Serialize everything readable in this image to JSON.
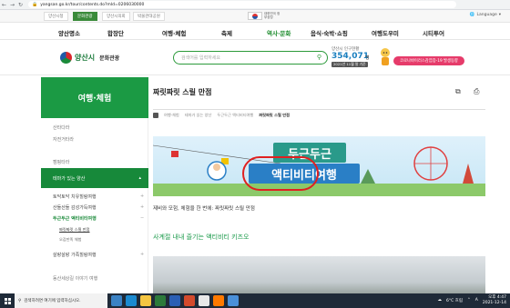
{
  "browser": {
    "url": "yangsan.go.kr/tour/contents.do?mId=0206030000",
    "lock_icon": "lock-icon"
  },
  "site_tabs": [
    {
      "label": "양산시청",
      "active": false
    },
    {
      "label": "문화관광",
      "active": true
    },
    {
      "label": "양산시의회",
      "active": false
    },
    {
      "label": "박물관대공원",
      "active": false
    }
  ],
  "emblem_text": "대한민국 정부상징",
  "language": "Language",
  "main_nav": [
    {
      "label": "양산명소",
      "highlight": false
    },
    {
      "label": "합장단",
      "highlight": false
    },
    {
      "label": "여행·체험",
      "highlight": false
    },
    {
      "label": "축제",
      "highlight": false
    },
    {
      "label": "역사·문화",
      "highlight": true
    },
    {
      "label": "음식·숙박·쇼핑",
      "highlight": false
    },
    {
      "label": "여행도우미",
      "highlight": false
    },
    {
      "label": "시티투어",
      "highlight": false
    }
  ],
  "logo": {
    "name": "양산시",
    "sub": "문화관광"
  },
  "search": {
    "placeholder": "검색어를 입력하세요"
  },
  "population": {
    "label": "양산시 인구현황",
    "value": "354,071",
    "unit": "명",
    "date": "2021년 11월 말 기준"
  },
  "covid_button": "코로나바이러스감염증-19 발생동향",
  "sidebar": {
    "header": "여행·체험",
    "items": [
      {
        "label": "산타다라"
      },
      {
        "label": "자전거타라"
      },
      {
        "label": "캠핑타라"
      }
    ],
    "highlight": "테마가 있는 양산",
    "sub_items": [
      {
        "label": "토닥토닥 치유힐링여행",
        "on": false
      },
      {
        "label": "산들산들 감성가득여행",
        "on": false
      },
      {
        "label": "두근두근 액티비티여행",
        "on": true
      }
    ],
    "sub_sub_items": [
      {
        "label": "짜릿짜릿 스릴 만점",
        "on": true
      },
      {
        "label": "오감만족 체험",
        "on": false
      }
    ],
    "more_items": [
      {
        "label": "살랑살랑 가족힐링여행"
      },
      {
        "label": "동산세상길 이야기 여행"
      }
    ]
  },
  "content": {
    "title": "짜릿짜릿 스릴 만점",
    "breadcrumb": [
      "여행·체험",
      "테마가 있는 양산",
      "두근두근 액티비티여행",
      "짜릿짜릿 스릴 만점"
    ],
    "banner_title1": "두근두근",
    "banner_title2": "액티비티여행",
    "description": "제비와 모험, 체험을 한 번에: 짜릿짜릿 스릴 만점",
    "subheading": "사계절 내내 즐기는 액티비티 키즈오"
  },
  "taskbar": {
    "search_placeholder": "검색하려면 여기에 입력하십시오.",
    "weather": "6°C 흐림",
    "ime": "A",
    "time": "오후 4:47",
    "date": "2021-12-14"
  },
  "colors": {
    "brand_green": "#1b9a44",
    "accent_blue": "#1a7fbf",
    "covid_pink": "#e63b6a"
  }
}
